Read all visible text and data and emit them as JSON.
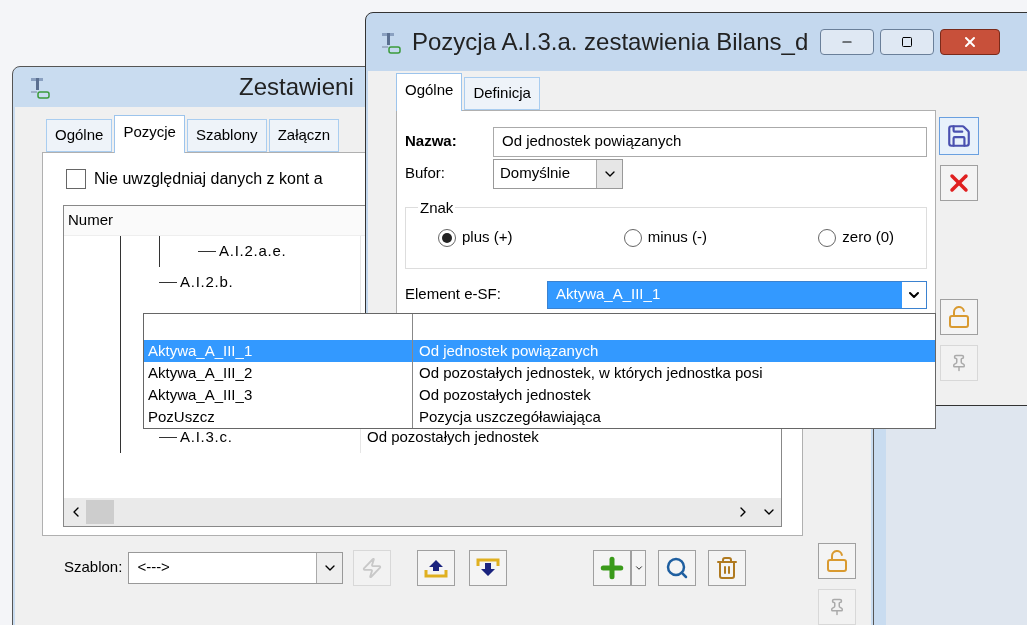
{
  "back_window": {
    "title": "Zestawieni",
    "tabs": [
      {
        "label": "Ogólne",
        "selected": false
      },
      {
        "label": "Pozycje",
        "selected": true
      },
      {
        "label": "Szablony",
        "selected": false
      },
      {
        "label": "Załączn",
        "selected": false
      }
    ],
    "checkbox": {
      "label": "Nie uwzględniaj danych z kont a",
      "checked": false
    },
    "tree": {
      "column_1": "Numer",
      "rows": [
        {
          "kind": "deep",
          "number": "A.I.2.a.e.",
          "description": ""
        },
        {
          "kind": "branch",
          "number": "A.I.2.b.",
          "description": ""
        },
        {
          "kind": "spacer",
          "number": "",
          "description": ""
        },
        {
          "kind": "spacer",
          "number": "",
          "description": ""
        },
        {
          "kind": "spacer",
          "number": "",
          "description": ""
        },
        {
          "kind": "spacer",
          "number": "",
          "description": ""
        },
        {
          "kind": "branch",
          "number": "A.I.3.c.",
          "description": "Od pozostałych jednostek"
        }
      ]
    },
    "template": {
      "label": "Szablon:",
      "value": "<--->"
    }
  },
  "front_window": {
    "title": "Pozycja A.I.3.a. zestawienia Bilans_d",
    "tabs": [
      {
        "label": "Ogólne",
        "selected": true
      },
      {
        "label": "Definicja",
        "selected": false
      }
    ],
    "name": {
      "label": "Nazwa:",
      "value": "Od jednostek powiązanych"
    },
    "buffer": {
      "label": "Bufor:",
      "value": "Domyślnie"
    },
    "sign": {
      "label": "Znak",
      "options": [
        {
          "label": "plus (+)",
          "selected": true
        },
        {
          "label": "minus (-)",
          "selected": false
        },
        {
          "label": "zero (0)",
          "selected": false
        }
      ]
    },
    "element": {
      "label": "Element e-SF:",
      "value": "Aktywa_A_III_1"
    }
  },
  "dropdown": {
    "rows": [
      {
        "code": "Aktywa_A_III_1",
        "description": "Od jednostek powiązanych",
        "selected": true
      },
      {
        "code": "Aktywa_A_III_2",
        "description": "Od pozostałych jednostek, w których jednostka posi",
        "selected": false
      },
      {
        "code": "Aktywa_A_III_3",
        "description": "Od pozostałych jednostek",
        "selected": false
      },
      {
        "code": "PozUszcz",
        "description": "Pozycja uszczegóławiająca",
        "selected": false
      }
    ]
  }
}
